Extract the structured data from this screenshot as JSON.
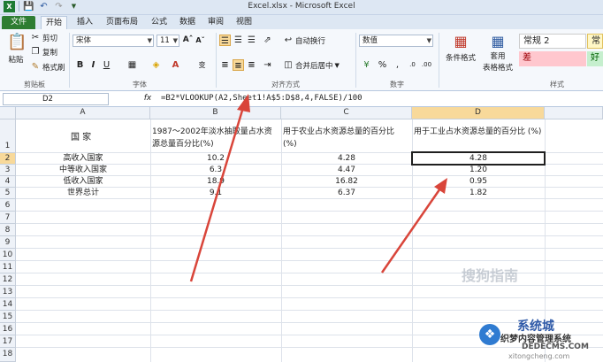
{
  "titlebar": {
    "title": "Excel.xlsx - Microsoft Excel"
  },
  "tabs": [
    "文件",
    "开始",
    "插入",
    "页面布局",
    "公式",
    "数据",
    "审阅",
    "视图"
  ],
  "ribbon": {
    "clipboard": {
      "paste": "粘贴",
      "cut": "剪切",
      "copy": "复制",
      "format_painter": "格式刷",
      "group_label": "剪贴板"
    },
    "font": {
      "font_name": "宋体",
      "font_size": "11",
      "group_label": "字体"
    },
    "alignment": {
      "wrap_text": "自动换行",
      "merge_center": "合并后居中",
      "group_label": "对齐方式"
    },
    "number": {
      "format": "数值",
      "group_label": "数字"
    },
    "styles": {
      "conditional_format": "条件格式",
      "table_format_line1": "套用",
      "table_format_line2": "表格格式",
      "style_normal2": "常规 2",
      "style_normal": "常",
      "style_bad": "差",
      "style_good": "好",
      "group_label": "样式"
    }
  },
  "formula_bar": {
    "name_box": "D2",
    "fx": "fx",
    "formula": "=B2*VLOOKUP(A2,Sheet1!A$5:D$8,4,FALSE)/100"
  },
  "columns": [
    "A",
    "B",
    "C",
    "D"
  ],
  "rows": [
    "1",
    "2",
    "3",
    "4",
    "5",
    "6",
    "7",
    "8",
    "9",
    "10",
    "11",
    "12",
    "13",
    "14",
    "15",
    "16",
    "17",
    "18"
  ],
  "sheet": {
    "header": {
      "a": "国    家",
      "b": "1987～2002年淡水抽取量占水资源总量百分比(%)",
      "c": "用于农业占水资源总量的百分比 (%)",
      "d": "用于工业占水资源总量的百分比 (%)"
    },
    "data": [
      {
        "a": "高收入国家",
        "b": "10.2",
        "c": "4.28",
        "d": "4.28"
      },
      {
        "a": "中等收入国家",
        "b": "6.3",
        "c": "4.47",
        "d": "1.20"
      },
      {
        "a": "低收入国家",
        "b": "18.9",
        "c": "16.82",
        "d": "0.95"
      },
      {
        "a": "世界总计",
        "b": "9.1",
        "c": "6.37",
        "d": "1.82"
      }
    ]
  },
  "annotations": {
    "arrow_color": "#d9453a"
  },
  "watermarks": {
    "sogou": "搜狗指南",
    "xitong": "系统城",
    "site1": "织梦内容管理系统",
    "site2": "DEDECMS.COM",
    "site3": "xitongcheng.com"
  }
}
